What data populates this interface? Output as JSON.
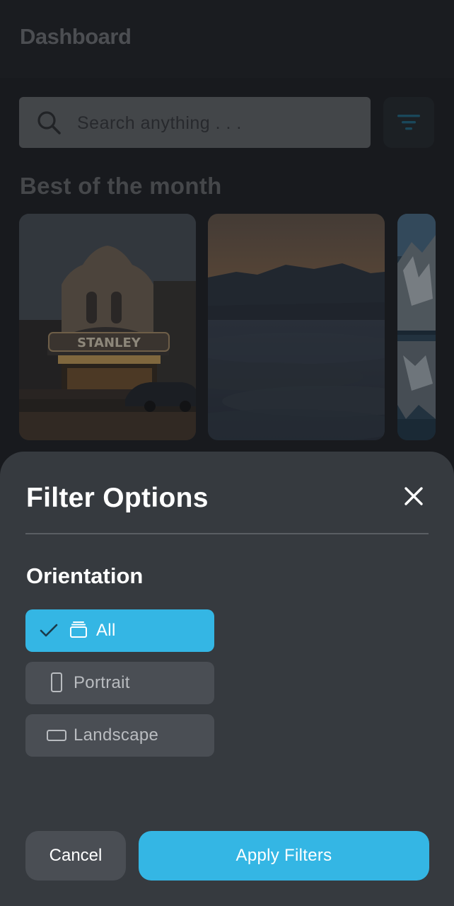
{
  "header": {
    "title": "Dashboard"
  },
  "search": {
    "placeholder": "Search anything . . ."
  },
  "section": {
    "title": "Best of the month"
  },
  "cards": [
    {
      "sign_text": "STANLEY"
    },
    {},
    {}
  ],
  "filter_sheet": {
    "title": "Filter Options",
    "group_label": "Orientation",
    "options": [
      {
        "label": "All",
        "selected": true
      },
      {
        "label": "Portrait",
        "selected": false
      },
      {
        "label": "Landscape",
        "selected": false
      }
    ],
    "cancel_label": "Cancel",
    "apply_label": "Apply Filters"
  },
  "colors": {
    "accent": "#34b6e4",
    "sheet_bg": "#363a3f",
    "option_bg": "#4a4e54"
  }
}
